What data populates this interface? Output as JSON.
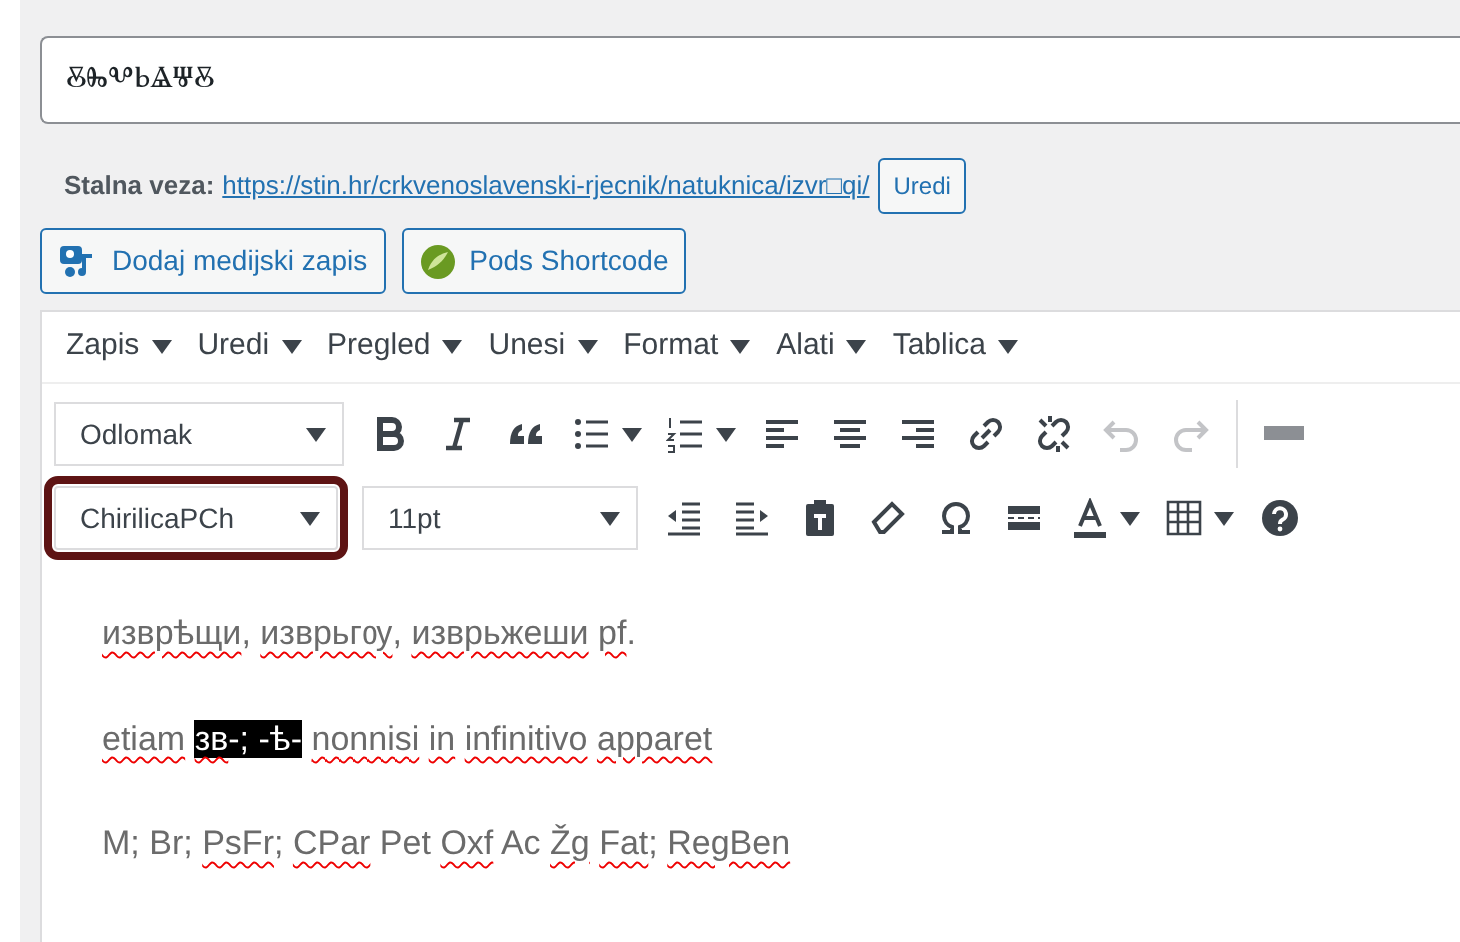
{
  "title_field": {
    "value": "ⰻⰸⰲⱃⱑⱋⰻ"
  },
  "permalink": {
    "label": "Stalna veza:",
    "url_prefix": "https://stin.hr/crkvenoslavenski-rjecnik/natuknica/",
    "slug": "izvr□qi",
    "url_suffix": "/",
    "edit_button": "Uredi"
  },
  "media_buttons": [
    {
      "kind": "media",
      "label": "Dodaj medijski zapis"
    },
    {
      "kind": "pods",
      "label": "Pods Shortcode"
    }
  ],
  "menubar": [
    "Zapis",
    "Uredi",
    "Pregled",
    "Unesi",
    "Format",
    "Alati",
    "Tablica"
  ],
  "format_select": {
    "value": "Odlomak",
    "highlighted": false
  },
  "font_select": {
    "value": "ChirilicaPCh",
    "highlighted": true
  },
  "size_select": {
    "value": "11pt",
    "highlighted": false
  },
  "paragraphs": [
    [
      {
        "text": "изврѣщи",
        "suffix": ",",
        "misspelled": true,
        "selected": false
      },
      {
        "text": "изврьгѹ",
        "suffix": ",",
        "misspelled": true,
        "selected": false
      },
      {
        "text": "изврьжеши",
        "misspelled": true,
        "selected": false
      },
      {
        "text": "pf",
        "suffix": ".",
        "misspelled": true,
        "selected": false
      }
    ],
    [
      {
        "text": "etiam",
        "misspelled": true,
        "selected": false
      },
      {
        "text": "зв",
        "suffix": "-;",
        "misspelled": true,
        "selected": true
      },
      {
        "text": "-ѣ-",
        "misspelled": false,
        "selected": true
      },
      {
        "text": "nonnisi",
        "misspelled": true,
        "selected": false
      },
      {
        "text": "in",
        "misspelled": true,
        "selected": false
      },
      {
        "text": "infinitivo",
        "misspelled": true,
        "selected": false
      },
      {
        "text": "apparet",
        "misspelled": true,
        "selected": false
      }
    ],
    [
      {
        "text": "M;",
        "misspelled": false,
        "selected": false
      },
      {
        "text": "Br;",
        "misspelled": false,
        "selected": false
      },
      {
        "text": "PsFr",
        "suffix": ";",
        "misspelled": true,
        "selected": false
      },
      {
        "text": "CPar",
        "misspelled": true,
        "selected": false
      },
      {
        "text": "Pet",
        "misspelled": false,
        "selected": false
      },
      {
        "text": "Oxf",
        "misspelled": true,
        "selected": false
      },
      {
        "text": "Ac",
        "misspelled": false,
        "selected": false
      },
      {
        "text": "Žg",
        "misspelled": true,
        "selected": false
      },
      {
        "text": "Fat",
        "suffix": ";",
        "misspelled": true,
        "selected": false
      },
      {
        "text": "RegBen",
        "misspelled": true,
        "selected": false
      }
    ]
  ]
}
